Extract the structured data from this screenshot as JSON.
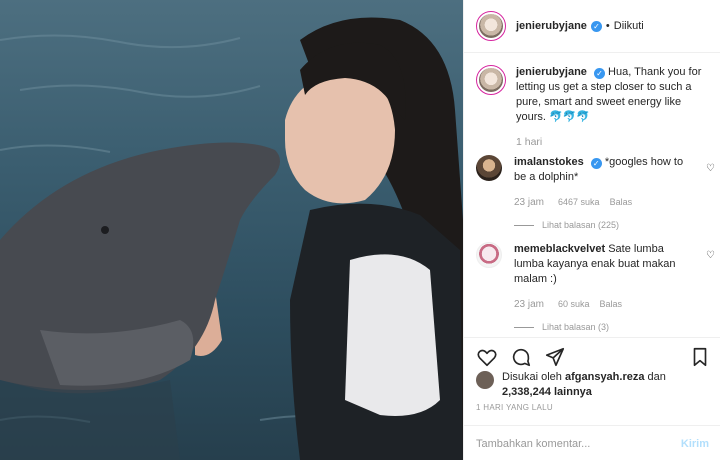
{
  "post": {
    "username": "jenierubyjane",
    "follow_status": "Diikuti",
    "caption": "Hua, Thank you for letting us get a step closer to such a pure, smart and sweet energy like yours.",
    "caption_emoji": "🐬🐬🐬",
    "caption_time": "1 hari"
  },
  "comments": [
    {
      "username": "imalanstokes",
      "text": "*googles how to be a dolphin*",
      "time": "23 jam",
      "likes": "6467 suka",
      "reply": "Balas",
      "view_replies": "Lihat balasan (225)"
    },
    {
      "username": "memeblackvelvet",
      "text": "Sate lumba lumba kayanya enak buat makan malam :)",
      "time": "23 jam",
      "likes": "60 suka",
      "reply": "Balas",
      "view_replies": "Lihat balasan (3)"
    }
  ],
  "likes": {
    "prefix": "Disukai oleh",
    "user": "afgansyah.reza",
    "connector": "dan",
    "count": "2,338,244 lainnya"
  },
  "post_age": "1 HARI YANG LALU",
  "comment_box": {
    "placeholder": "Tambahkan komentar...",
    "send_label": "Kirim"
  },
  "colors": {
    "verified": "#3897f0",
    "muted_text": "#999999",
    "send_disabled": "#b2dffc"
  }
}
